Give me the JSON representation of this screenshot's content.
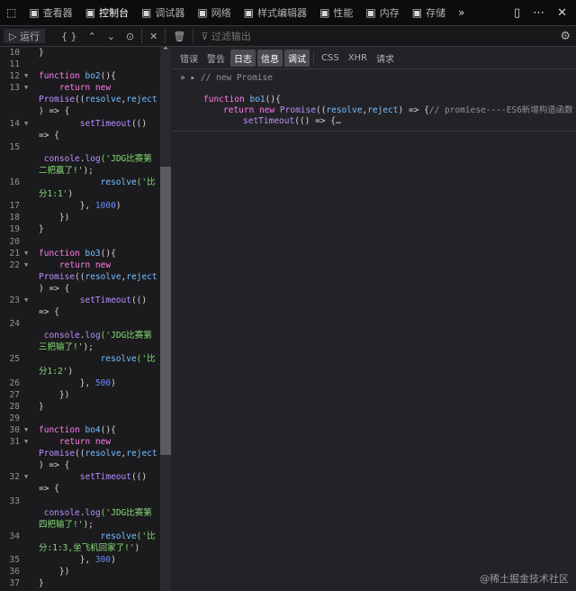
{
  "tabs": [
    {
      "label": "查看器",
      "icon": "inspector-icon"
    },
    {
      "label": "控制台",
      "icon": "console-icon",
      "selected": true
    },
    {
      "label": "调试器",
      "icon": "debugger-icon"
    },
    {
      "label": "网络",
      "icon": "network-icon"
    },
    {
      "label": "样式编辑器",
      "icon": "style-editor-icon"
    },
    {
      "label": "性能",
      "icon": "performance-icon"
    },
    {
      "label": "内存",
      "icon": "memory-icon"
    },
    {
      "label": "存储",
      "icon": "storage-icon"
    }
  ],
  "toolbar": {
    "run": "运行",
    "pretty": "{ }",
    "filter_placeholder": "过滤输出"
  },
  "filters": [
    {
      "label": "错误"
    },
    {
      "label": "警告"
    },
    {
      "label": "日志",
      "on": true
    },
    {
      "label": "信息",
      "on": true
    },
    {
      "label": "调试",
      "on": true
    },
    {
      "label": "CSS"
    },
    {
      "label": "XHR"
    },
    {
      "label": "请求"
    }
  ],
  "output": {
    "head": "// new Promise",
    "l1": [
      [
        "kw",
        "function "
      ],
      [
        "fn",
        "bo1"
      ],
      [
        "pl",
        "(){"
      ]
    ],
    "l2": [
      [
        "kw",
        "return new "
      ],
      [
        "id",
        "Promise"
      ],
      [
        "pl",
        "(("
      ],
      [
        "fn",
        "resolve"
      ],
      [
        "pl",
        ","
      ],
      [
        "fn",
        "reject"
      ],
      [
        "pl",
        ") => {"
      ],
      [
        "pn",
        "// promiese----ES6新增构造函数"
      ]
    ],
    "l3": [
      [
        "id",
        "setTimeout"
      ],
      [
        "pl",
        "(() => {…"
      ]
    ]
  },
  "editor_rows": [
    {
      "n": "10",
      "t": [
        [
          "pl",
          "}"
        ]
      ]
    },
    {
      "n": "11",
      "t": []
    },
    {
      "n": "12",
      "f": 1,
      "t": [
        [
          "kw",
          "function "
        ],
        [
          "fn",
          "bo2"
        ],
        [
          "pl",
          "(){"
        ]
      ]
    },
    {
      "n": "13",
      "f": 1,
      "t": [
        [
          "kw",
          "    return new"
        ]
      ]
    },
    {
      "t": [
        [
          "id",
          "Promise"
        ],
        [
          "pl",
          "(("
        ],
        [
          "fn",
          "resolve"
        ],
        [
          "pl",
          ","
        ],
        [
          "fn",
          "reject"
        ]
      ]
    },
    {
      "t": [
        [
          "pl",
          ") => {"
        ]
      ]
    },
    {
      "n": "14",
      "f": 1,
      "t": [
        [
          "id",
          "        setTimeout"
        ],
        [
          "pl",
          "(()"
        ]
      ]
    },
    {
      "t": [
        [
          "pl",
          "=> {"
        ]
      ]
    },
    {
      "n": "15",
      "t": []
    },
    {
      "t": [
        [
          "id",
          " console"
        ],
        [
          "pl",
          "."
        ],
        [
          "id",
          "log"
        ],
        [
          "st",
          "('JDG比赛第"
        ]
      ]
    },
    {
      "t": [
        [
          "st",
          "二把赢了!'"
        ],
        [
          "pl",
          ");"
        ]
      ]
    },
    {
      "n": "16",
      "t": [
        [
          "fn",
          "            resolve"
        ],
        [
          "st",
          "('比"
        ]
      ]
    },
    {
      "t": [
        [
          "st",
          "分1:1'"
        ],
        [
          "pl",
          ")"
        ]
      ]
    },
    {
      "n": "17",
      "t": [
        [
          "pl",
          "        }, "
        ],
        [
          "nm",
          "1000"
        ],
        [
          "pl",
          ")"
        ]
      ]
    },
    {
      "n": "18",
      "t": [
        [
          "pl",
          "    })"
        ]
      ]
    },
    {
      "n": "19",
      "t": [
        [
          "pl",
          "}"
        ]
      ]
    },
    {
      "n": "20",
      "t": []
    },
    {
      "n": "21",
      "f": 1,
      "t": [
        [
          "kw",
          "function "
        ],
        [
          "fn",
          "bo3"
        ],
        [
          "pl",
          "(){"
        ]
      ]
    },
    {
      "n": "22",
      "f": 1,
      "t": [
        [
          "kw",
          "    return new"
        ]
      ]
    },
    {
      "t": [
        [
          "id",
          "Promise"
        ],
        [
          "pl",
          "(("
        ],
        [
          "fn",
          "resolve"
        ],
        [
          "pl",
          ","
        ],
        [
          "fn",
          "reject"
        ]
      ]
    },
    {
      "t": [
        [
          "pl",
          ") => {"
        ]
      ]
    },
    {
      "n": "23",
      "f": 1,
      "t": [
        [
          "id",
          "        setTimeout"
        ],
        [
          "pl",
          "(()"
        ]
      ]
    },
    {
      "t": [
        [
          "pl",
          "=> {"
        ]
      ]
    },
    {
      "n": "24",
      "t": []
    },
    {
      "t": [
        [
          "id",
          " console"
        ],
        [
          "pl",
          "."
        ],
        [
          "id",
          "log"
        ],
        [
          "st",
          "('JDG比赛第"
        ]
      ]
    },
    {
      "t": [
        [
          "st",
          "三把输了!'"
        ],
        [
          "pl",
          ");"
        ]
      ]
    },
    {
      "n": "25",
      "t": [
        [
          "fn",
          "            resolve"
        ],
        [
          "st",
          "('比"
        ]
      ]
    },
    {
      "t": [
        [
          "st",
          "分1:2'"
        ],
        [
          "pl",
          ")"
        ]
      ]
    },
    {
      "n": "26",
      "t": [
        [
          "pl",
          "        }, "
        ],
        [
          "nm",
          "500"
        ],
        [
          "pl",
          ")"
        ]
      ]
    },
    {
      "n": "27",
      "t": [
        [
          "pl",
          "    })"
        ]
      ]
    },
    {
      "n": "28",
      "t": [
        [
          "pl",
          "}"
        ]
      ]
    },
    {
      "n": "29",
      "t": []
    },
    {
      "n": "30",
      "f": 1,
      "t": [
        [
          "kw",
          "function "
        ],
        [
          "fn",
          "bo4"
        ],
        [
          "pl",
          "(){"
        ]
      ]
    },
    {
      "n": "31",
      "f": 1,
      "t": [
        [
          "kw",
          "    return new"
        ]
      ]
    },
    {
      "t": [
        [
          "id",
          "Promise"
        ],
        [
          "pl",
          "(("
        ],
        [
          "fn",
          "resolve"
        ],
        [
          "pl",
          ","
        ],
        [
          "fn",
          "reject"
        ]
      ]
    },
    {
      "t": [
        [
          "pl",
          ") => {"
        ]
      ]
    },
    {
      "n": "32",
      "f": 1,
      "t": [
        [
          "id",
          "        setTimeout"
        ],
        [
          "pl",
          "(()"
        ]
      ]
    },
    {
      "t": [
        [
          "pl",
          "=> {"
        ]
      ]
    },
    {
      "n": "33",
      "t": []
    },
    {
      "t": [
        [
          "id",
          " console"
        ],
        [
          "pl",
          "."
        ],
        [
          "id",
          "log"
        ],
        [
          "st",
          "('JDG比赛第"
        ]
      ]
    },
    {
      "t": [
        [
          "st",
          "四把输了!'"
        ],
        [
          "pl",
          ");"
        ]
      ]
    },
    {
      "n": "34",
      "t": [
        [
          "fn",
          "            resolve"
        ],
        [
          "st",
          "('比"
        ]
      ]
    },
    {
      "t": [
        [
          "st",
          "分:1:3,坐飞机回家了!'"
        ],
        [
          "pl",
          ")"
        ]
      ]
    },
    {
      "n": "35",
      "t": [
        [
          "pl",
          "        }, "
        ],
        [
          "nm",
          "300"
        ],
        [
          "pl",
          ")"
        ]
      ]
    },
    {
      "n": "36",
      "t": [
        [
          "pl",
          "    })"
        ]
      ]
    },
    {
      "n": "37",
      "t": [
        [
          "pl",
          "}"
        ]
      ]
    }
  ],
  "watermark": "@稀土掘金技术社区"
}
